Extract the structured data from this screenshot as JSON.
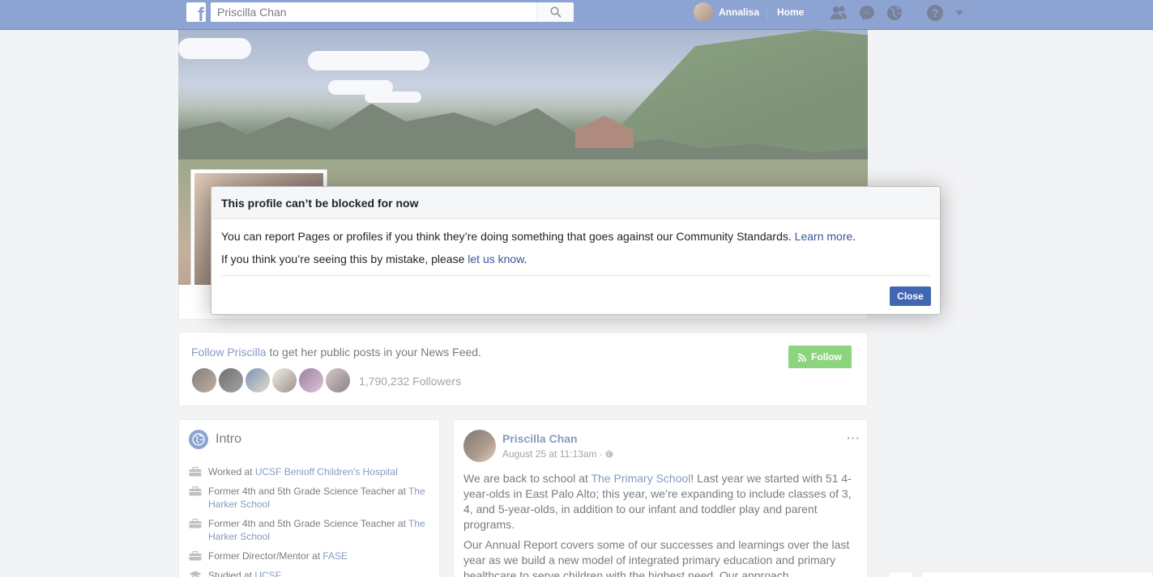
{
  "topbar": {
    "search_value": "Priscilla Chan",
    "user_name": "Annalisa",
    "home_label": "Home",
    "brand_color": "#4267b2"
  },
  "follow": {
    "link_text": "Follow Priscilla",
    "rest_text": " to get her public posts in your News Feed.",
    "button_label": "Follow",
    "followers_count": "1,790,232 Followers"
  },
  "intro": {
    "title": "Intro",
    "items": [
      {
        "icon": "briefcase-icon",
        "prefix": "Worked at ",
        "link": "UCSF Benioff Children's Hospital"
      },
      {
        "icon": "briefcase-icon",
        "prefix": "Former 4th and 5th Grade Science Teacher at ",
        "link": "The Harker School"
      },
      {
        "icon": "briefcase-icon",
        "prefix": "Former 4th and 5th Grade Science Teacher at ",
        "link": "The Harker School"
      },
      {
        "icon": "briefcase-icon",
        "prefix": "Former Director/Mentor at ",
        "link": "FASE"
      },
      {
        "icon": "graduation-cap-icon",
        "prefix": "Studied at ",
        "link": "UCSF"
      }
    ]
  },
  "post": {
    "author": "Priscilla Chan",
    "meta": "August 25 at 11:13am · ",
    "more": "···",
    "p1_before": "We are back to school at ",
    "p1_link": "The Primary School",
    "p1_after": "! Last year we started with 51 4-year-olds in East Palo Alto; this year, we’re expanding to include classes of 3, 4, and 5-year-olds, in addition to our infant and toddler play and parent programs.",
    "p2": "Our Annual Report covers some of our successes and learnings over the last year as we build a new model of integrated primary education and primary healthcare to serve children with the highest need. Our approach"
  },
  "dialog": {
    "title": "This profile can’t be blocked for now",
    "line1_text": "You can report Pages or profiles if you think they’re doing something that goes against our Community Standards. ",
    "line1_link": "Learn more",
    "line1_end": ".",
    "line2_text": "If you think you’re seeing this by mistake, please ",
    "line2_link": "let us know",
    "line2_end": ".",
    "close_label": "Close"
  }
}
